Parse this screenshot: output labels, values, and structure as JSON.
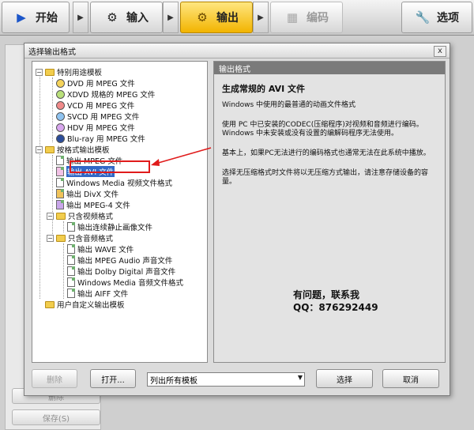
{
  "toolbar": {
    "start": "开始",
    "input": "输入",
    "output": "输出",
    "encode": "编码",
    "options": "选项"
  },
  "background_panel": {
    "delete": "删除",
    "save": "保存(S)"
  },
  "dialog": {
    "title": "选择输出格式",
    "close": "x",
    "tree": {
      "special": "特别用途模板",
      "dvd": "DVD 用 MPEG 文件",
      "xdvd": "XDVD 规格的 MPEG 文件",
      "vcd": "VCD 用 MPEG 文件",
      "svcd": "SVCD 用 MPEG 文件",
      "hdv": "HDV 用 MPEG 文件",
      "bluray": "Blu-ray 用 MPEG 文件",
      "by_format": "按格式输出模板",
      "out_mpeg": "输出 MPEG 文件",
      "out_avi": "输出 AVI 文件",
      "out_wmv": "Windows Media 视频文件格式",
      "out_divx": "输出 DivX 文件",
      "out_mpeg4": "输出 MPEG-4 文件",
      "video_only": "只含视频格式",
      "out_still": "输出连续静止画像文件",
      "audio_only": "只含音频格式",
      "out_wave": "输出 WAVE 文件",
      "out_mpeg_audio": "输出 MPEG Audio 声音文件",
      "out_dolby": "输出 Dolby Digital 声音文件",
      "out_wma": "Windows Media 音频文件格式",
      "out_aiff": "输出 AIFF 文件",
      "user_defined": "用户自定义输出模板"
    },
    "info": {
      "header": "输出格式",
      "title": "生成常规的 AVI 文件",
      "p1": "Windows 中使用的最普通的动画文件格式",
      "p2": "使用 PC 中已安装的CODEC(压缩程序)对视频和音频进行编码。Windows 中未安装或没有设置的编解码程序无法使用。",
      "p3": "基本上，如果PC无法进行的编码格式也通常无法在此系统中播放。",
      "p4": "选择无压缩格式时文件将以无压缩方式输出，请注意存储设备的容量。",
      "watermark1": "有问题，联系我",
      "watermark2": "QQ：876292449"
    },
    "buttons": {
      "delete": "删除",
      "open": "打开...",
      "filter": "列出所有模板",
      "select": "选择",
      "cancel": "取消"
    }
  },
  "colors": {
    "accent": "#f2b400",
    "selection": "#3168c6",
    "highlight_red": "#e01b1b"
  }
}
